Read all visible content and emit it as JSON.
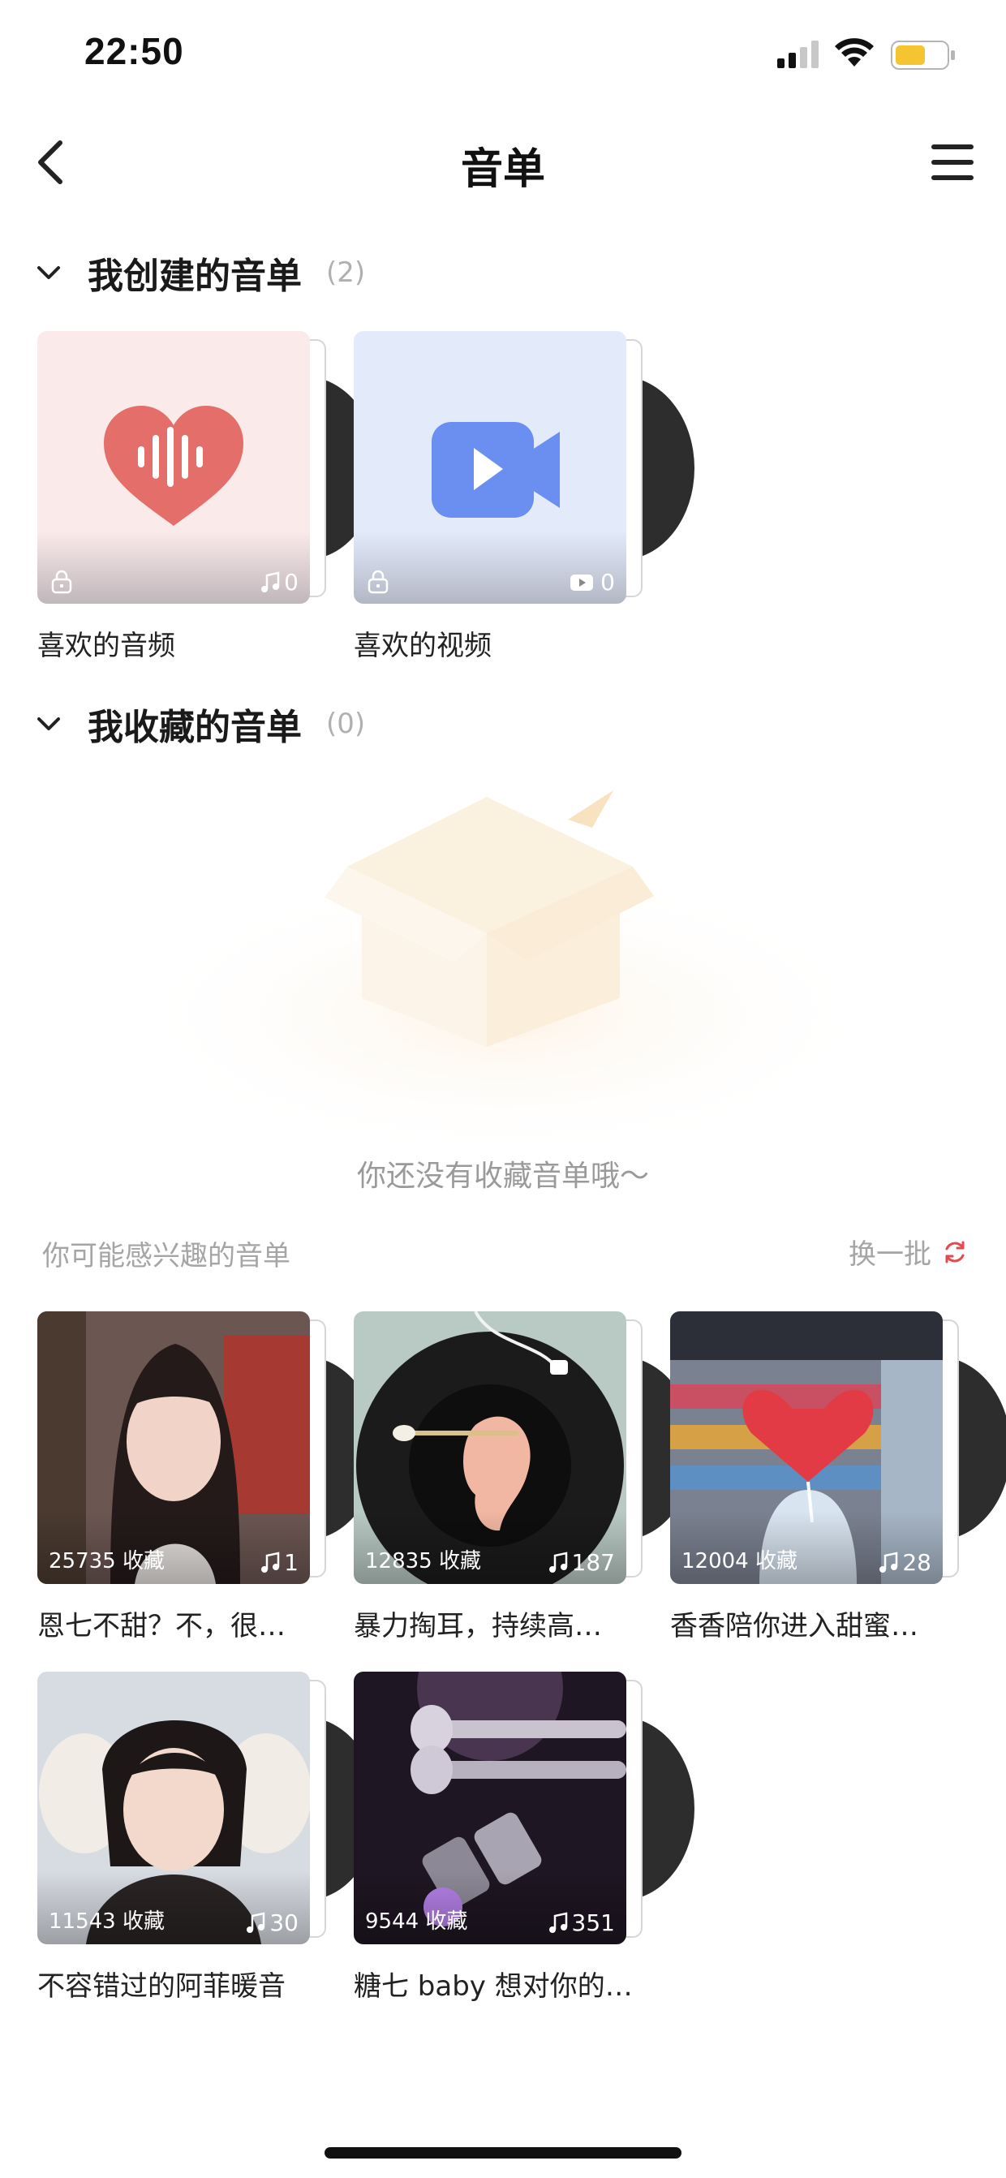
{
  "status_bar": {
    "time": "22:50"
  },
  "nav": {
    "title": "音单"
  },
  "created_section": {
    "title": "我创建的音单",
    "count": "(2)"
  },
  "created_playlists": [
    {
      "caption": "喜欢的音频",
      "count": "0",
      "icon": "heart-audio-icon",
      "bg": "#fbeaea",
      "accent": "#e46f6a"
    },
    {
      "caption": "喜欢的视频",
      "count": "0",
      "icon": "video-camera-icon",
      "bg": "#e3ebfb",
      "accent": "#6b8ff0"
    }
  ],
  "collected_section": {
    "title": "我收藏的音单",
    "count": "(0)"
  },
  "empty_state": {
    "text": "你还没有收藏音单哦～"
  },
  "suggest": {
    "title": "你可能感兴趣的音单",
    "refresh_label": "换一批",
    "accent": "#e5484d"
  },
  "suggested_playlists": [
    {
      "caption": "恩七不甜？不，很…",
      "favorites": "25735 收藏",
      "count": "1"
    },
    {
      "caption": "暴力掏耳，持续高…",
      "favorites": "12835 收藏",
      "count": "187"
    },
    {
      "caption": "香香陪你进入甜蜜…",
      "favorites": "12004 收藏",
      "count": "28"
    },
    {
      "caption": "不容错过的阿菲暖音",
      "favorites": "11543 收藏",
      "count": "30"
    },
    {
      "caption": "糖七 baby 想对你的…",
      "favorites": "9544 收藏",
      "count": "351"
    }
  ]
}
